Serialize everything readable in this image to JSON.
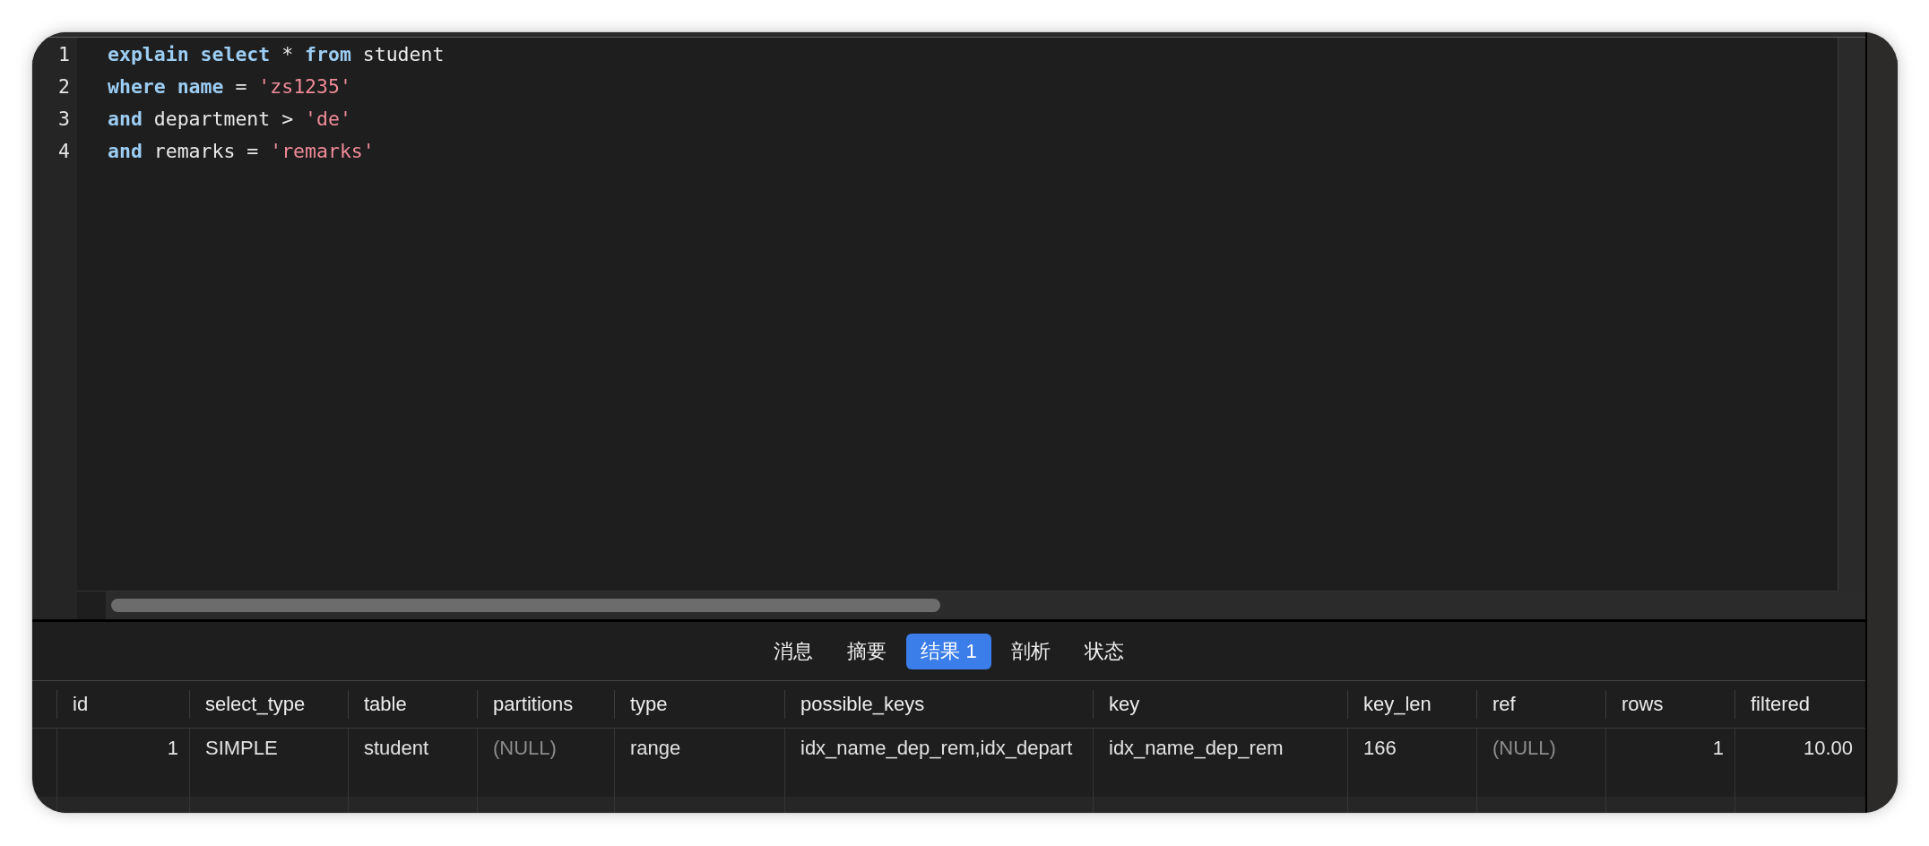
{
  "editor": {
    "lines": [
      {
        "number": "1",
        "tokens": [
          {
            "kind": "keyword",
            "text": "explain select"
          },
          {
            "kind": "plain",
            "text": " * "
          },
          {
            "kind": "keyword",
            "text": "from"
          },
          {
            "kind": "plain",
            "text": " student"
          }
        ]
      },
      {
        "number": "2",
        "tokens": [
          {
            "kind": "keyword",
            "text": "where name"
          },
          {
            "kind": "plain",
            "text": " = "
          },
          {
            "kind": "string",
            "text": "'zs1235'"
          }
        ]
      },
      {
        "number": "3",
        "tokens": [
          {
            "kind": "keyword",
            "text": "and"
          },
          {
            "kind": "plain",
            "text": " department > "
          },
          {
            "kind": "string",
            "text": "'de'"
          }
        ]
      },
      {
        "number": "4",
        "tokens": [
          {
            "kind": "keyword",
            "text": "and"
          },
          {
            "kind": "plain",
            "text": " remarks = "
          },
          {
            "kind": "string",
            "text": "'remarks'"
          }
        ]
      }
    ]
  },
  "tabs": [
    {
      "label": "消息",
      "selected": false
    },
    {
      "label": "摘要",
      "selected": false
    },
    {
      "label": "结果 1",
      "selected": true
    },
    {
      "label": "剖析",
      "selected": false
    },
    {
      "label": "状态",
      "selected": false
    }
  ],
  "table": {
    "columns": [
      "id",
      "select_type",
      "table",
      "partitions",
      "type",
      "possible_keys",
      "key",
      "key_len",
      "ref",
      "rows",
      "filtered"
    ],
    "rows": [
      {
        "cells": [
          {
            "kind": "number",
            "text": "1"
          },
          {
            "kind": "text",
            "text": "SIMPLE"
          },
          {
            "kind": "text",
            "text": "student"
          },
          {
            "kind": "null",
            "text": "(NULL)"
          },
          {
            "kind": "text",
            "text": "range"
          },
          {
            "kind": "text",
            "text": "idx_name_dep_rem,idx_depart"
          },
          {
            "kind": "text",
            "text": "idx_name_dep_rem"
          },
          {
            "kind": "text",
            "text": "166"
          },
          {
            "kind": "null",
            "text": "(NULL)"
          },
          {
            "kind": "number",
            "text": "1"
          },
          {
            "kind": "number",
            "text": "10.00"
          }
        ]
      }
    ]
  }
}
